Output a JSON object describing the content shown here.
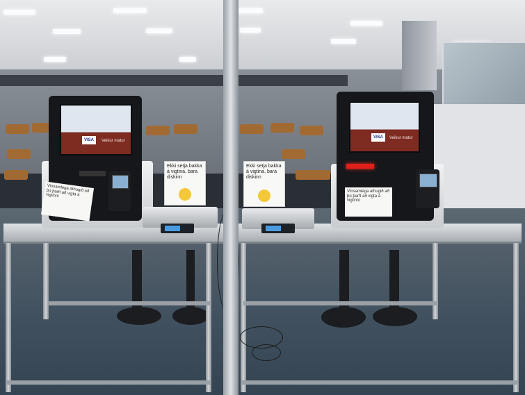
{
  "scene": {
    "description_icons": [
      "payment-kiosk",
      "card-terminal",
      "weighing-scale",
      "sign-card",
      "smiley-icon"
    ],
    "colors": {
      "screen_accent": "#7e2b22",
      "visa_blue": "#1a2a80",
      "reader_red": "#e0201a",
      "scale_digits": "#4a9be0"
    }
  },
  "kiosk_left": {
    "card_label": "VISA",
    "screen_text": "Veikur matur",
    "note": "Vinsamlega athugið að þú þarft að vigta á vigtinni"
  },
  "kiosk_right": {
    "card_label": "VISA",
    "screen_text": "Veikur matur",
    "note": "Vinsamlega athugið að þú þarft að vigta á vigtinni"
  },
  "sign_left": {
    "text": "Ekki setja bakka á vigtina, bara diskinn"
  },
  "sign_right": {
    "text": "Ekki setja bakka á vigtina, bara diskinn"
  }
}
